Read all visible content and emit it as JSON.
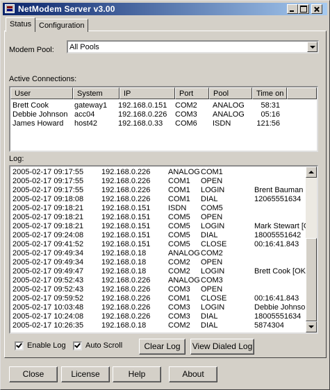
{
  "window": {
    "title": "NetModem Server v3.00"
  },
  "tabs": [
    {
      "label": "Status"
    },
    {
      "label": "Configuration"
    }
  ],
  "modem_pool": {
    "label": "Modem Pool:",
    "value": "All Pools"
  },
  "active": {
    "label": "Active Connections:",
    "columns": [
      "User",
      "System",
      "IP",
      "Port",
      "Pool",
      "Time on"
    ],
    "rows": [
      [
        "Brett Cook",
        "gateway1",
        "192.168.0.151",
        "COM2",
        "ANALOG",
        "58:31"
      ],
      [
        "Debbie Johnson",
        "acc04",
        "192.168.0.226",
        "COM3",
        "ANALOG",
        "05:16"
      ],
      [
        "James Howard",
        "host42",
        "192.168.0.33",
        "COM6",
        "ISDN",
        "121:56"
      ]
    ]
  },
  "log": {
    "label": "Log:",
    "rows": [
      [
        "2005-02-17 09:17:55",
        "192.168.0.226",
        "ANALOG",
        "COM1",
        "",
        ""
      ],
      [
        "2005-02-17 09:17:55",
        "192.168.0.226",
        "COM1",
        "OPEN",
        "",
        ""
      ],
      [
        "2005-02-17 09:17:55",
        "192.168.0.226",
        "COM1",
        "LOGIN",
        "Brent Bauman [OK]",
        ""
      ],
      [
        "2005-02-17 09:18:08",
        "192.168.0.226",
        "COM1",
        "DIAL",
        "12065551634",
        ""
      ],
      [
        "2005-02-17 09:18:21",
        "192.168.0.151",
        "ISDN",
        "COM5",
        "",
        ""
      ],
      [
        "2005-02-17 09:18:21",
        "192.168.0.151",
        "COM5",
        "OPEN",
        "",
        ""
      ],
      [
        "2005-02-17 09:18:21",
        "192.168.0.151",
        "COM5",
        "LOGIN",
        "Mark Stewart [OK]",
        ""
      ],
      [
        "2005-02-17 09:24:08",
        "192.168.0.151",
        "COM5",
        "DIAL",
        "18005551642",
        ""
      ],
      [
        "2005-02-17 09:41:52",
        "192.168.0.151",
        "COM5",
        "CLOSE",
        "00:16:41.843",
        ""
      ],
      [
        "2005-02-17 09:49:34",
        "192.168.0.18",
        "ANALOG",
        "COM2",
        "",
        ""
      ],
      [
        "2005-02-17 09:49:34",
        "192.168.0.18",
        "COM2",
        "OPEN",
        "",
        ""
      ],
      [
        "2005-02-17 09:49:47",
        "192.168.0.18",
        "COM2",
        "LOGIN",
        "Brett Cook [OK]",
        ""
      ],
      [
        "2005-02-17 09:52:43",
        "192.168.0.226",
        "ANALOG",
        "COM3",
        "",
        ""
      ],
      [
        "2005-02-17 09:52:43",
        "192.168.0.226",
        "COM3",
        "OPEN",
        "",
        ""
      ],
      [
        "2005-02-17 09:59:52",
        "192.168.0.226",
        "COM1",
        "CLOSE",
        "00:16:41.843",
        ""
      ],
      [
        "2005-02-17 10:03:48",
        "192.168.0.226",
        "COM3",
        "LOGIN",
        "Debbie Johnson [OK]",
        ""
      ],
      [
        "2005-02-17 10:24:08",
        "192.168.0.226",
        "COM3",
        "DIAL",
        "18005551634",
        ""
      ],
      [
        "2005-02-17 10:26:35",
        "192.168.0.18",
        "COM2",
        "DIAL",
        "5874304",
        ""
      ]
    ]
  },
  "options": {
    "enable_log": "Enable Log",
    "auto_scroll": "Auto Scroll",
    "clear_log": "Clear Log",
    "view_dialed_log": "View Dialed Log"
  },
  "footer": {
    "close": "Close",
    "license": "License",
    "help": "Help",
    "about": "About"
  }
}
